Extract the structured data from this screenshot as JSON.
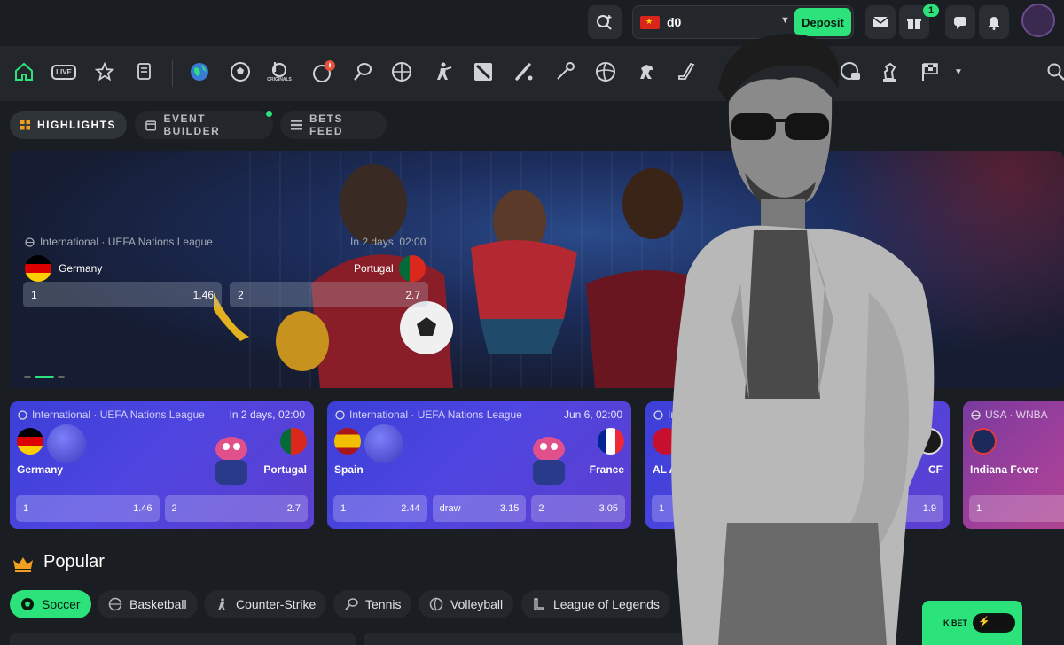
{
  "topbar": {
    "balance": "đ0",
    "deposit_label": "Deposit",
    "gift_badge": "1"
  },
  "sports_nav": {
    "live_label": "LIVE",
    "originals_label": "ORIGINALS",
    "icons": [
      "home-icon",
      "live-icon",
      "star-icon",
      "betslip-icon",
      "globe-icon",
      "soccer-icon",
      "originals-icon",
      "hot-sports-icon",
      "tennis-icon",
      "basketball-icon",
      "counter-strike-icon",
      "dota-icon",
      "cricket-icon",
      "badminton-icon",
      "volleyball-icon",
      "horse-racing-icon",
      "hockey-icon",
      "esports-basketball-icon",
      "chess-icon",
      "racing-flag-icon",
      "search-icon"
    ]
  },
  "tabs": [
    {
      "label": "HIGHLIGHTS",
      "active": true
    },
    {
      "label": "EVENT BUILDER",
      "active": false
    },
    {
      "label": "BETS FEED",
      "active": false
    }
  ],
  "banner": {
    "league": "International · UEFA Nations League",
    "time": "In 2 days, 02:00",
    "team1": "Germany",
    "team2": "Portugal",
    "odds": [
      {
        "label": "1",
        "value": "1.46"
      },
      {
        "label": "2",
        "value": "2.7"
      }
    ]
  },
  "cards": [
    {
      "league": "International · UEFA Nations League",
      "time": "In 2 days, 02:00",
      "team1": "Germany",
      "team2": "Portugal",
      "odds": [
        {
          "label": "1",
          "value": "1.46"
        },
        {
          "label": "2",
          "value": "2.7"
        }
      ]
    },
    {
      "league": "International · UEFA Nations League",
      "time": "Jun 6, 02:00",
      "team1": "Spain",
      "team2": "France",
      "odds": [
        {
          "label": "1",
          "value": "2.44"
        },
        {
          "label": "draw",
          "value": "3.15"
        },
        {
          "label": "2",
          "value": "3.05"
        }
      ]
    },
    {
      "league": "Inte",
      "time": "",
      "team1": "AL Ah",
      "team2": "CF",
      "odds": [
        {
          "label": "1",
          "value": ""
        },
        {
          "label": "",
          "value": "1.9"
        }
      ]
    },
    {
      "league": "USA · WNBA",
      "time": "",
      "team1": "Indiana Fever",
      "team2": "",
      "odds": [
        {
          "label": "1",
          "value": ""
        }
      ]
    }
  ],
  "popular": {
    "title": "Popular",
    "chips": [
      {
        "label": "Soccer",
        "active": true
      },
      {
        "label": "Basketball",
        "active": false
      },
      {
        "label": "Counter-Strike",
        "active": false
      },
      {
        "label": "Tennis",
        "active": false
      },
      {
        "label": "Volleyball",
        "active": false
      },
      {
        "label": "League of Legends",
        "active": false
      }
    ],
    "quick_bet_label": "K BET"
  },
  "colors": {
    "accent_green": "#2be37a",
    "background": "#1a1d21",
    "card_blue": "#4f45e0",
    "card_pink": "#a2409a"
  }
}
